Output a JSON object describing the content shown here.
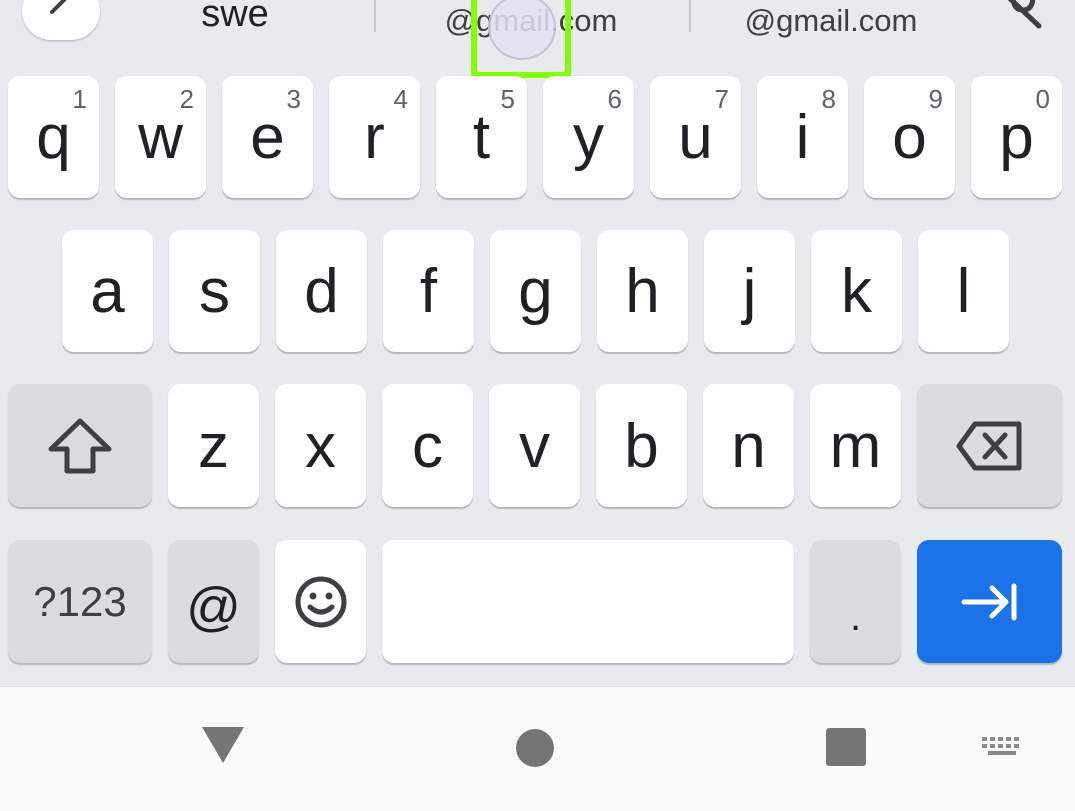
{
  "suggestions": {
    "items": [
      "swe",
      "@gmail.com",
      "@gmail.com"
    ]
  },
  "keyboard": {
    "row1": [
      {
        "letter": "q",
        "hint": "1"
      },
      {
        "letter": "w",
        "hint": "2"
      },
      {
        "letter": "e",
        "hint": "3"
      },
      {
        "letter": "r",
        "hint": "4"
      },
      {
        "letter": "t",
        "hint": "5"
      },
      {
        "letter": "y",
        "hint": "6"
      },
      {
        "letter": "u",
        "hint": "7"
      },
      {
        "letter": "i",
        "hint": "8"
      },
      {
        "letter": "o",
        "hint": "9"
      },
      {
        "letter": "p",
        "hint": "0"
      }
    ],
    "row2": [
      "a",
      "s",
      "d",
      "f",
      "g",
      "h",
      "j",
      "k",
      "l"
    ],
    "row3": [
      "z",
      "x",
      "c",
      "v",
      "b",
      "n",
      "m"
    ],
    "row4": {
      "symbols_label": "?123",
      "at_label": "@",
      "period_label": "."
    }
  },
  "colors": {
    "keyboard_bg": "#e8eaed",
    "key": "#ffffff",
    "key_dark": "#dadce0",
    "accent": "#1a73e8",
    "highlight": "#7fff00"
  },
  "icons": {
    "expand": "chevron-right-icon",
    "mic_off": "mic-off-icon",
    "shift": "shift-icon",
    "backspace": "backspace-icon",
    "emoji": "emoji-icon",
    "next": "tab-next-icon",
    "back": "nav-back-icon",
    "home": "nav-home-icon",
    "recents": "nav-recents-icon",
    "keyboard_switch": "keyboard-icon"
  }
}
